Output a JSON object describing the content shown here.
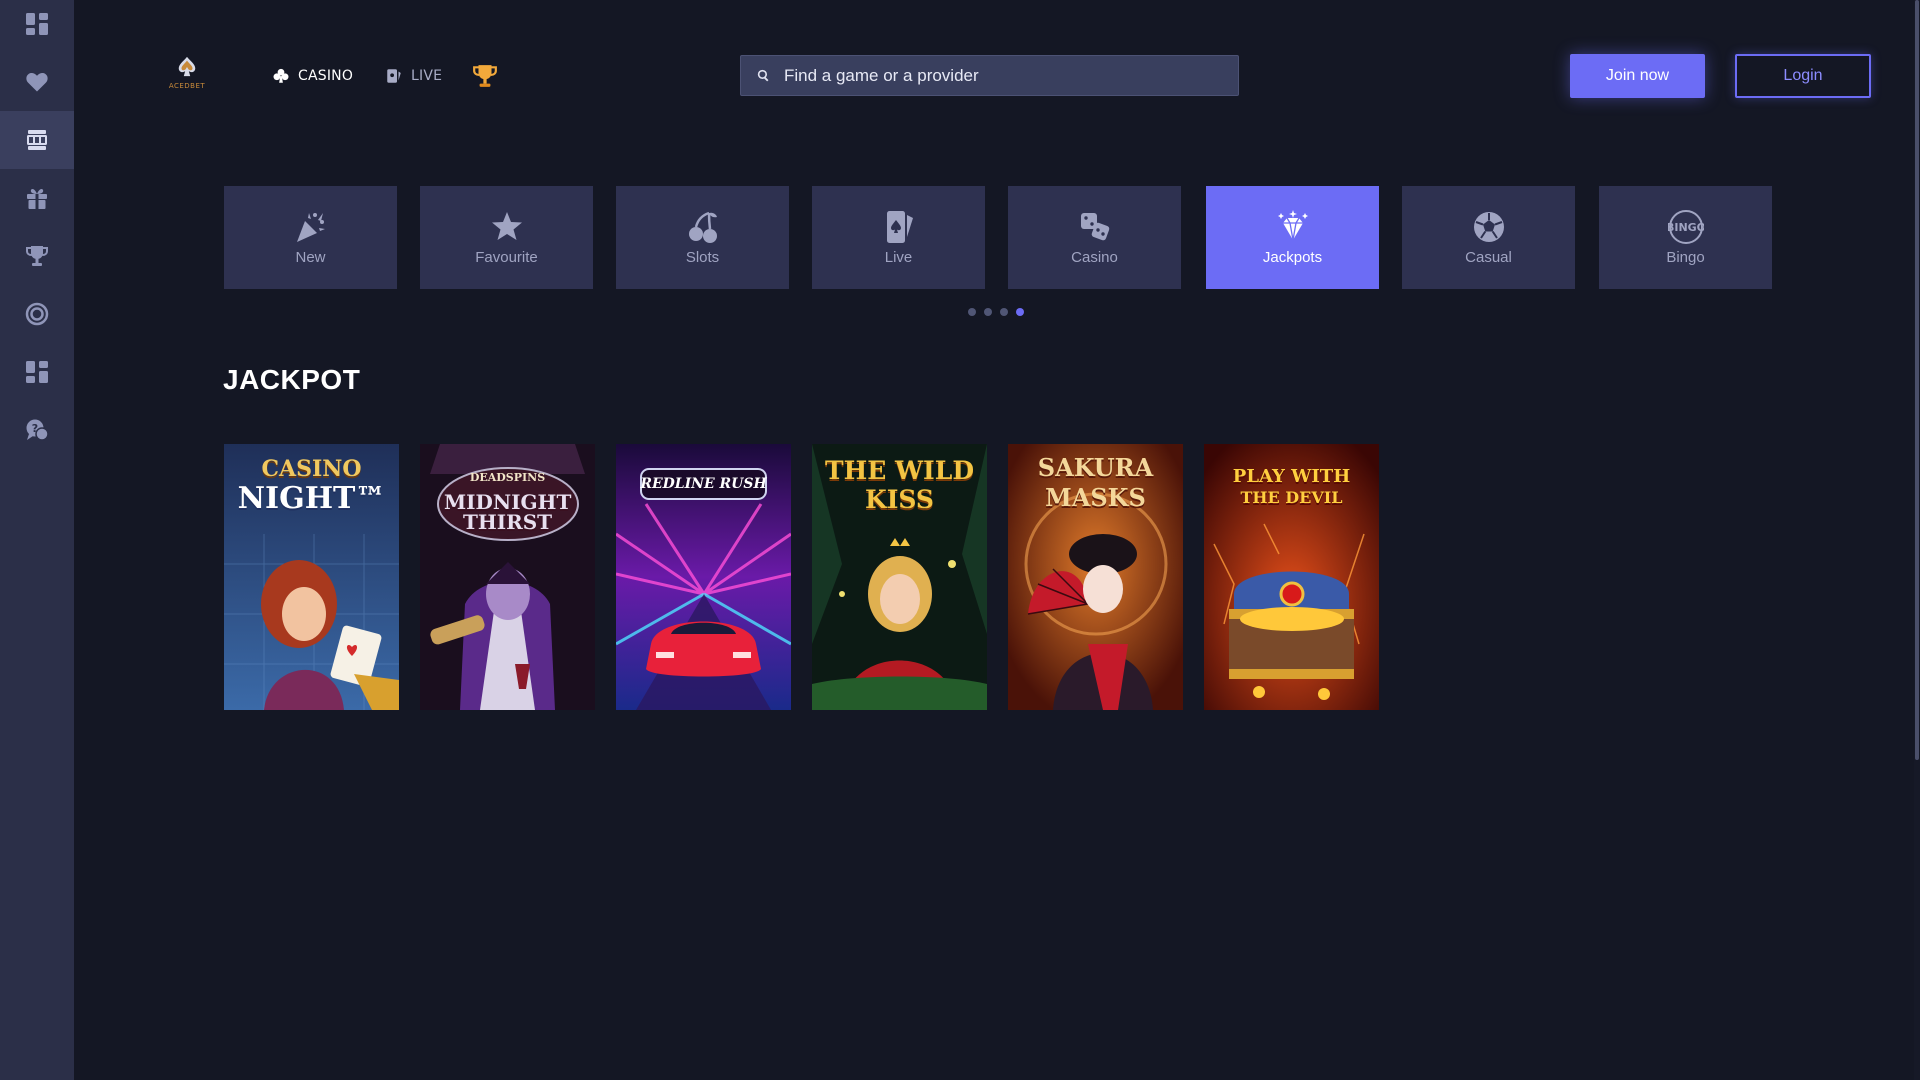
{
  "header": {
    "logo_text": "ACEDBET",
    "nav": [
      {
        "label": "CASINO",
        "icon": "clubs-icon"
      },
      {
        "label": "LIVE",
        "icon": "live-cards-icon"
      },
      {
        "label": "",
        "icon": "trophy-icon"
      }
    ],
    "search": {
      "placeholder": "Find a game or a provider",
      "value": ""
    },
    "join_label": "Join now",
    "login_label": "Login"
  },
  "sidebar": {
    "items": [
      {
        "icon": "dashboard-icon",
        "active": false
      },
      {
        "icon": "heart-icon",
        "active": false
      },
      {
        "icon": "slot-machine-icon",
        "active": true
      },
      {
        "icon": "gift-icon",
        "active": false
      },
      {
        "icon": "trophy-icon",
        "active": false
      },
      {
        "icon": "target-icon",
        "active": false
      },
      {
        "icon": "grid-icon",
        "active": false
      },
      {
        "icon": "support-chat-icon",
        "active": false
      }
    ]
  },
  "categories": [
    {
      "label": "New",
      "icon": "confetti-icon",
      "active": false
    },
    {
      "label": "Favourite",
      "icon": "star-icon",
      "active": false
    },
    {
      "label": "Slots",
      "icon": "cherries-icon",
      "active": false
    },
    {
      "label": "Live",
      "icon": "card-phone-icon",
      "active": false
    },
    {
      "label": "Casino",
      "icon": "dice-icon",
      "active": false
    },
    {
      "label": "Jackpots",
      "icon": "diamond-icon",
      "active": true
    },
    {
      "label": "Casual",
      "icon": "soccer-ball-icon",
      "active": false
    },
    {
      "label": "Bingo",
      "icon": "bingo-icon",
      "active": false
    }
  ],
  "carousel": {
    "page_count": 4,
    "active_page": 4
  },
  "section": {
    "title": "JACKPOT"
  },
  "games": [
    {
      "title_line1": "CASINO",
      "title_line2": "NIGHT™",
      "bg": "#2b4a80",
      "accent": "#e8c25a"
    },
    {
      "title_line1": "DEADSPINS",
      "title_line2": "MIDNIGHT THIRST",
      "bg": "#2a1830",
      "accent": "#d9d2e6"
    },
    {
      "title_line1": "REDLINE RUSH",
      "title_line2": "",
      "bg": "#3b1470",
      "accent": "#ffffff"
    },
    {
      "title_line1": "THE WILD",
      "title_line2": "KISS",
      "bg": "#0e2318",
      "accent": "#f3c443"
    },
    {
      "title_line1": "SAKURA",
      "title_line2": "MASKS",
      "bg": "#6a2418",
      "accent": "#f4d79a"
    },
    {
      "title_line1": "PLAY WITH",
      "title_line2": "THE DEVIL",
      "bg": "#5a0c08",
      "accent": "#ffcf3f"
    }
  ]
}
